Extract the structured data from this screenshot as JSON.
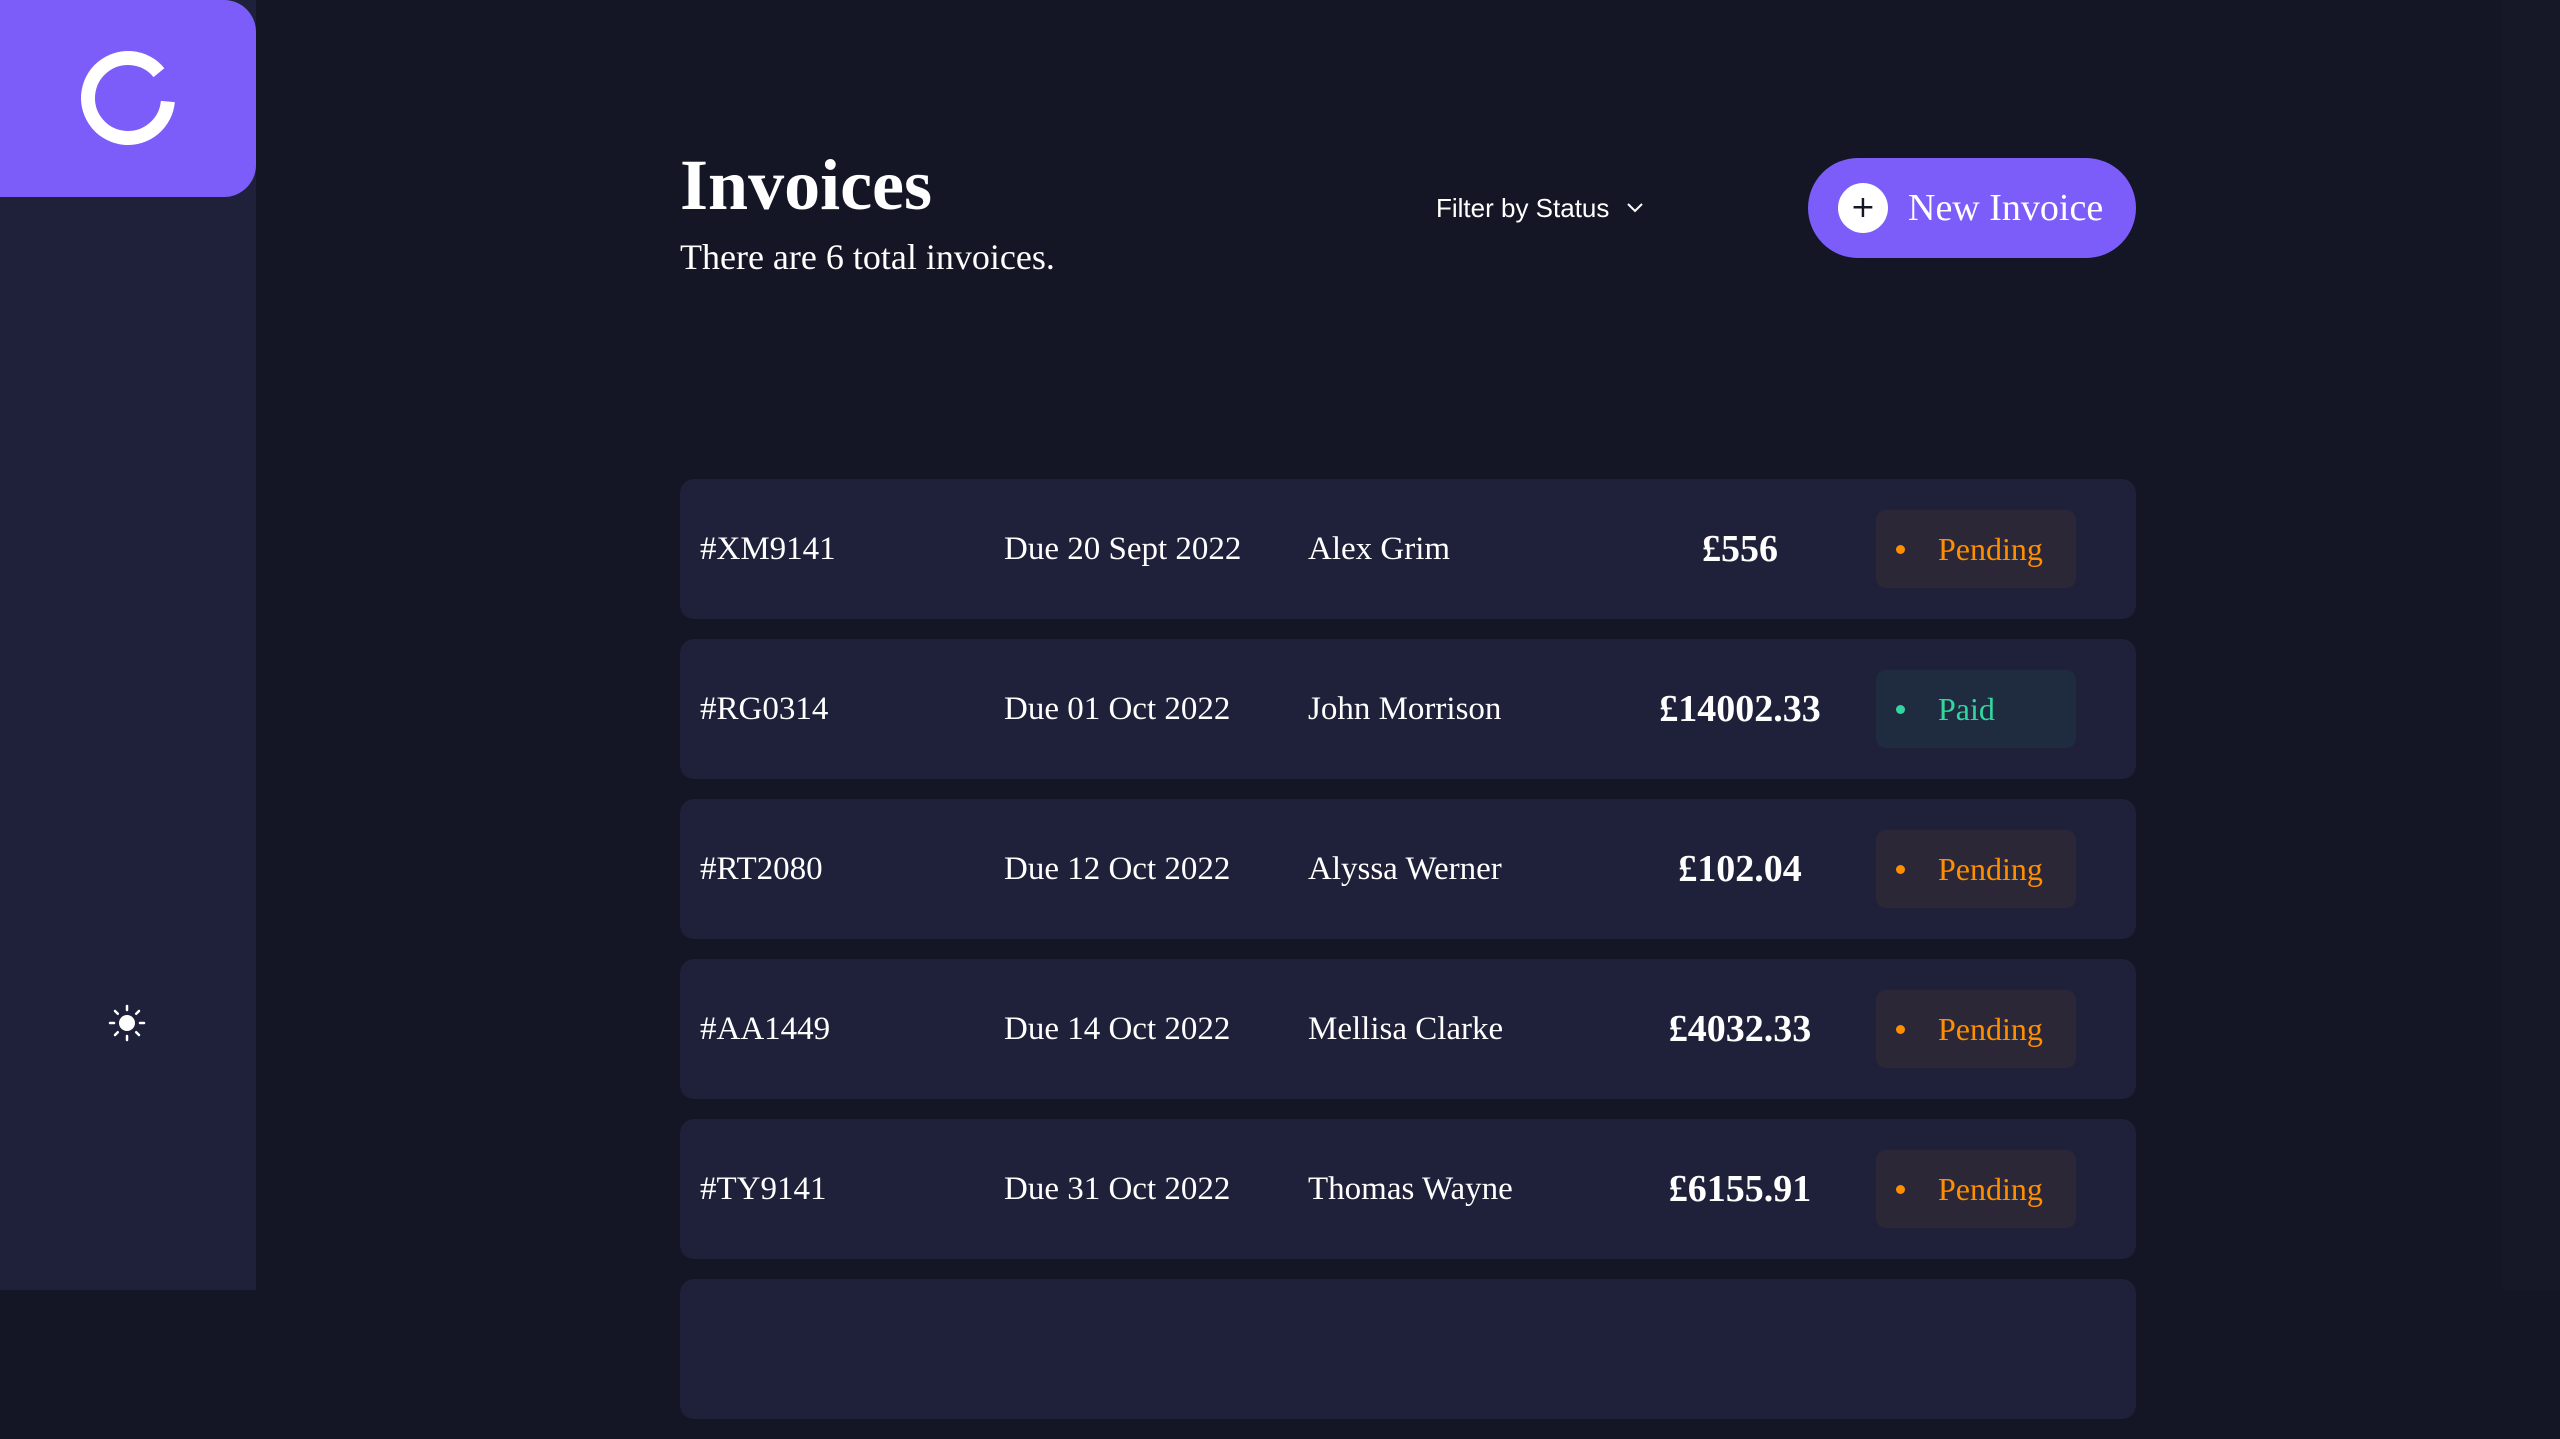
{
  "header": {
    "title": "Invoices",
    "subtitle": "There are 6 total invoices.",
    "filter_label": "Filter by Status",
    "new_invoice_label": "New Invoice"
  },
  "colors": {
    "accent": "#7c5dfa",
    "background": "#141625",
    "card": "#1e2139",
    "pending": "#ff8f00",
    "paid": "#33d69f"
  },
  "icons": {
    "logo": "logo-ring-icon",
    "theme": "sun-icon",
    "filter": "chevron-down-icon",
    "new": "plus-icon"
  },
  "invoices": [
    {
      "id": "#XM9141",
      "due": "Due 20 Sept 2022",
      "name": "Alex Grim",
      "amount": "£556",
      "status": "Pending"
    },
    {
      "id": "#RG0314",
      "due": "Due 01 Oct 2022",
      "name": "John Morrison",
      "amount": "£14002.33",
      "status": "Paid"
    },
    {
      "id": "#RT2080",
      "due": "Due 12 Oct 2022",
      "name": "Alyssa Werner",
      "amount": "£102.04",
      "status": "Pending"
    },
    {
      "id": "#AA1449",
      "due": "Due 14 Oct 2022",
      "name": "Mellisa Clarke",
      "amount": "£4032.33",
      "status": "Pending"
    },
    {
      "id": "#TY9141",
      "due": "Due 31 Oct 2022",
      "name": "Thomas Wayne",
      "amount": "£6155.91",
      "status": "Pending"
    }
  ]
}
